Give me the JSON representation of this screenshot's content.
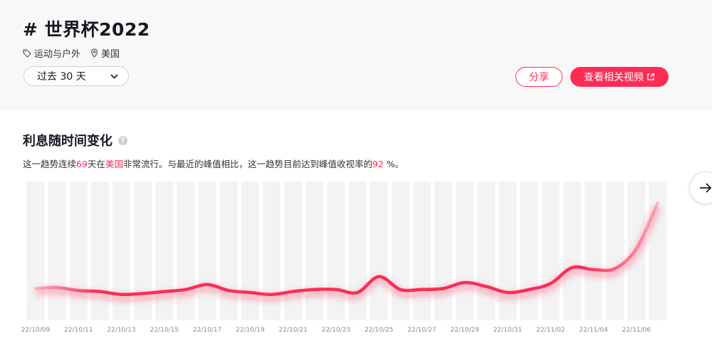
{
  "header": {
    "title": "# 世界杯2022",
    "category": "运动与户外",
    "region": "美国",
    "range_label": "过去 30 天",
    "share_label": "分享",
    "view_label": "查看相关视频"
  },
  "section": {
    "title": "利息随时间变化",
    "desc": {
      "p1": "这一趋势连续",
      "days": "69",
      "p2": "天在",
      "region": "美国",
      "p3": "非常流行。与最近的峰值相比，这一趋势目前达到峰值收视率的",
      "pct": "92",
      "p4": " %。"
    }
  },
  "colors": {
    "accent": "#fe2c55",
    "band": "#f3f3f4"
  },
  "chart_data": {
    "type": "line",
    "title": "",
    "xlabel": "",
    "ylabel": "",
    "x_tick_labels": [
      "22/10/09",
      "22/10/11",
      "22/10/13",
      "22/10/15",
      "22/10/17",
      "22/10/19",
      "22/10/21",
      "22/10/23",
      "22/10/25",
      "22/10/27",
      "22/10/29",
      "22/10/31",
      "22/11/02",
      "22/11/04",
      "22/11/06"
    ],
    "x": [
      "22/10/09",
      "22/10/10",
      "22/10/11",
      "22/10/12",
      "22/10/13",
      "22/10/14",
      "22/10/15",
      "22/10/16",
      "22/10/17",
      "22/10/18",
      "22/10/19",
      "22/10/20",
      "22/10/21",
      "22/10/22",
      "22/10/23",
      "22/10/24",
      "22/10/25",
      "22/10/26",
      "22/10/27",
      "22/10/28",
      "22/10/29",
      "22/10/30",
      "22/10/31",
      "22/11/01",
      "22/11/02",
      "22/11/03",
      "22/11/04",
      "22/11/05",
      "22/11/06",
      "22/11/07"
    ],
    "series": [
      {
        "values": [
          14,
          15,
          12,
          11,
          8,
          9,
          11,
          13,
          18,
          12,
          10,
          8,
          11,
          13,
          13,
          10,
          26,
          13,
          13,
          14,
          20,
          16,
          10,
          13,
          19,
          35,
          33,
          34,
          54,
          100
        ]
      }
    ],
    "ylim": [
      0,
      100
    ],
    "grid": false
  }
}
